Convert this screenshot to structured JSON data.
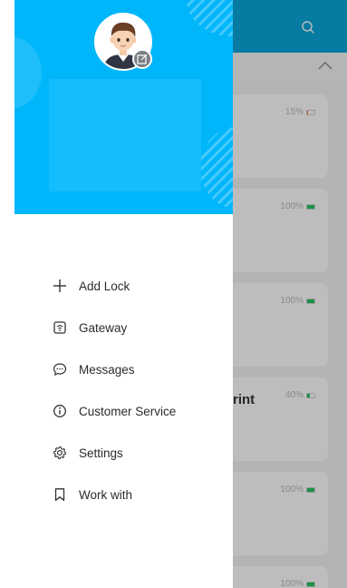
{
  "background": {
    "header_color": "#0aa6da",
    "search_icon": "search-icon",
    "collapse_icon": "chevron-up-icon",
    "cards": [
      {
        "battery": "15%",
        "battery_level": 0.15,
        "battery_color": "#ff6a3c",
        "name": ""
      },
      {
        "battery": "100%",
        "battery_level": 1.0,
        "battery_color": "#22c55e",
        "name": ""
      },
      {
        "battery": "100%",
        "battery_level": 1.0,
        "battery_color": "#22c55e",
        "name": ""
      },
      {
        "battery": "40%",
        "battery_level": 0.4,
        "battery_color": "#22c55e",
        "name": "rint"
      },
      {
        "battery": "100%",
        "battery_level": 1.0,
        "battery_color": "#22c55e",
        "name": ""
      },
      {
        "battery": "100%",
        "battery_level": 1.0,
        "battery_color": "#22c55e",
        "name": ""
      }
    ]
  },
  "drawer": {
    "header_color": "#00b6fb",
    "avatar_icon": "avatar",
    "edit_icon": "edit-icon",
    "menu": [
      {
        "label": "Add Lock",
        "icon": "plus-icon"
      },
      {
        "label": "Gateway",
        "icon": "gateway-icon"
      },
      {
        "label": "Messages",
        "icon": "message-icon"
      },
      {
        "label": "Customer Service",
        "icon": "info-icon"
      },
      {
        "label": "Settings",
        "icon": "gear-icon"
      },
      {
        "label": "Work with",
        "icon": "bookmark-icon"
      }
    ]
  }
}
